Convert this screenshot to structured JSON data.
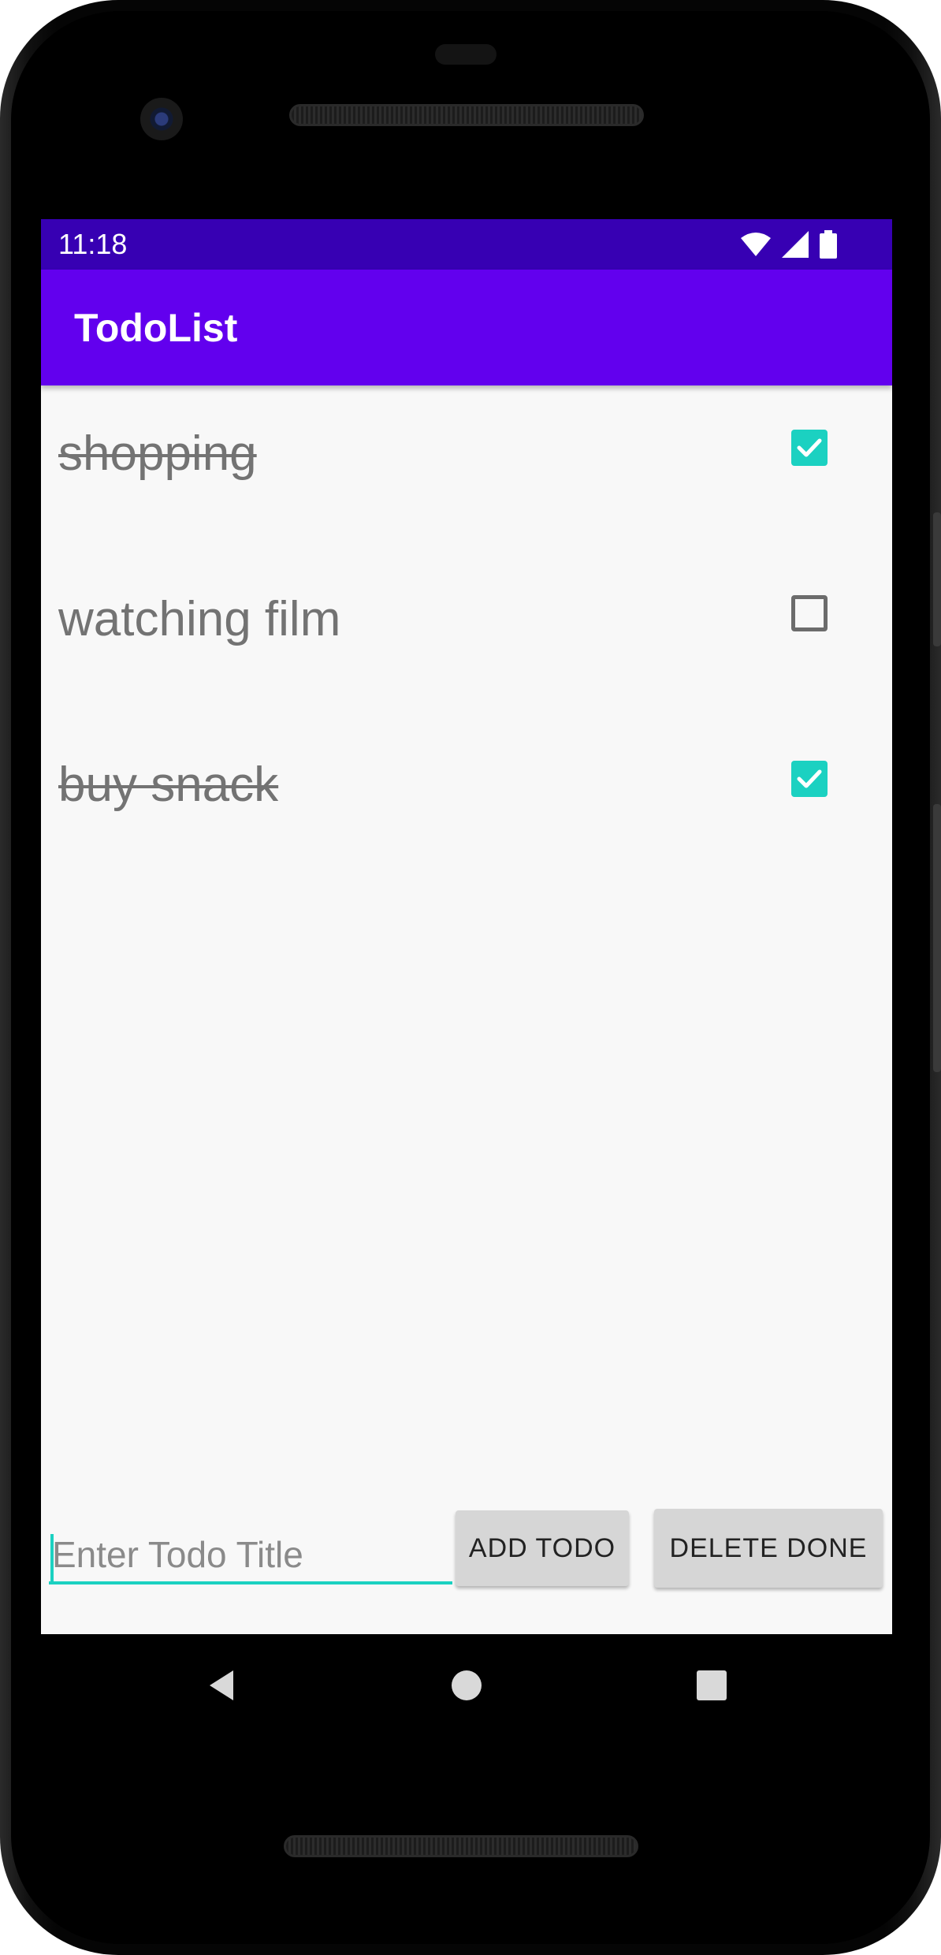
{
  "status_bar": {
    "time": "11:18",
    "icons": [
      "wifi-icon",
      "cell-signal-icon",
      "battery-icon"
    ],
    "background": "#3700b3"
  },
  "app_bar": {
    "title": "TodoList",
    "background": "#6200ee"
  },
  "todos": [
    {
      "title": "shopping",
      "done": true
    },
    {
      "title": "watching film",
      "done": false
    },
    {
      "title": "buy snack",
      "done": true
    }
  ],
  "input": {
    "value": "",
    "placeholder": "Enter Todo Title"
  },
  "buttons": {
    "add_label": "ADD TODO",
    "delete_label": "DELETE DONE"
  },
  "nav_bar": {
    "icons": [
      "back-icon",
      "home-icon",
      "recents-icon"
    ]
  },
  "colors": {
    "accent": "#1bd1c1",
    "primary": "#6200ee",
    "primary_dark": "#3700b3"
  }
}
